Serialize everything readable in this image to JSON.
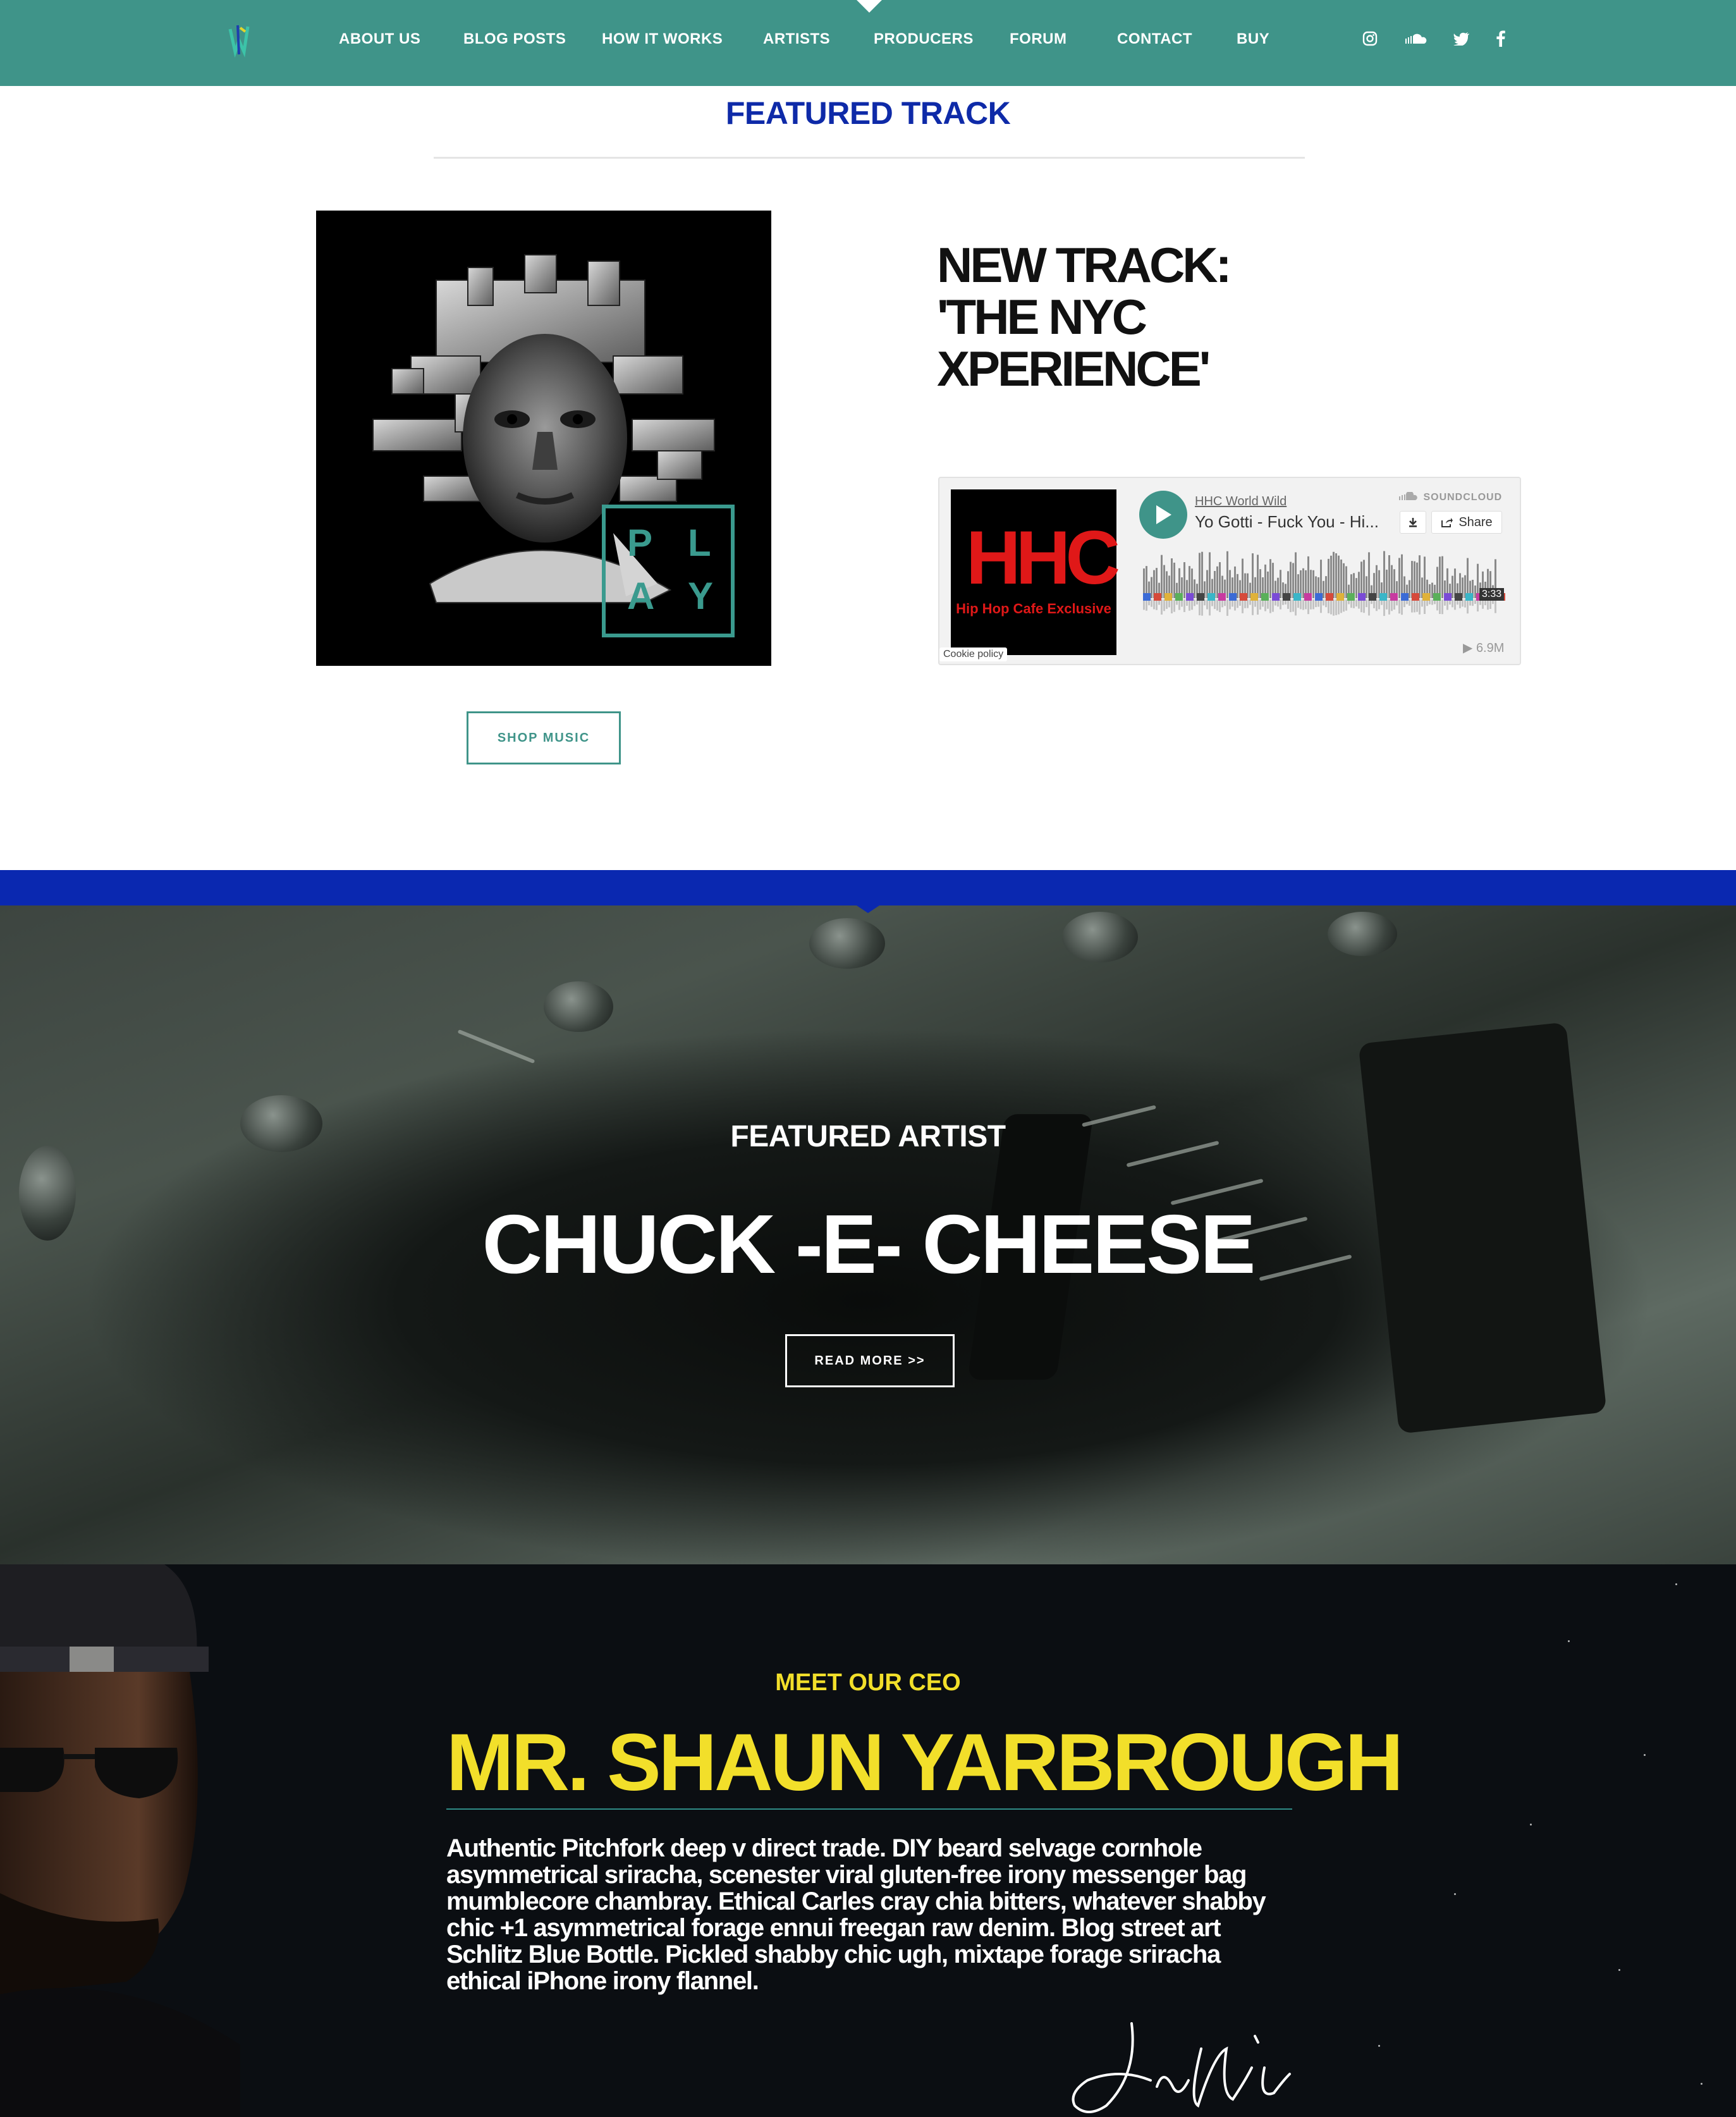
{
  "nav": {
    "items": [
      "ABOUT US",
      "BLOG POSTS",
      "HOW IT WORKS",
      "ARTISTS",
      "PRODUCERS",
      "FORUM",
      "CONTACT",
      "BUY"
    ],
    "social": [
      "instagram-icon",
      "soundcloud-icon",
      "twitter-icon",
      "facebook-icon"
    ]
  },
  "featured_track": {
    "section_title": "FEATURED TRACK",
    "album_letters": [
      "P",
      "L",
      "A",
      "Y"
    ],
    "heading": "NEW TRACK: 'THE NYC XPERIENCE'",
    "shop_button": "SHOP MUSIC"
  },
  "soundcloud": {
    "user": "HHC World Wild",
    "track": "Yo Gotti - Fuck You - Hi...",
    "brand": "SOUNDCLOUD",
    "share": "Share",
    "duration": "3:33",
    "plays": "▶ 6.9M",
    "cookie": "Cookie policy",
    "art_text": "HHC",
    "art_subtext": "Hip Hop Cafe Exclusive"
  },
  "featured_artist": {
    "label": "FEATURED ARTIST",
    "name": "CHUCK -E- CHEESE",
    "button": "READ MORE >>"
  },
  "ceo": {
    "label": "MEET OUR CEO",
    "name": "MR. SHAUN YARBROUGH",
    "bio": "Authentic Pitchfork deep v direct trade. DIY beard selvage cornhole asymmetrical sriracha, scenester viral gluten-free irony messenger bag mumblecore chambray. Ethical Carles cray chia bitters, whatever shabby chic +1 asymmetrical forage ennui freegan raw denim. Blog street art Schlitz Blue Bottle. Pickled shabby chic ugh, mixtape forage sriracha ethical iPhone irony flannel."
  },
  "colors": {
    "nav_bg": "#3f9489",
    "title_blue": "#0e2aa8",
    "band_blue": "#0a28b0",
    "ceo_yellow": "#f2df2a"
  }
}
